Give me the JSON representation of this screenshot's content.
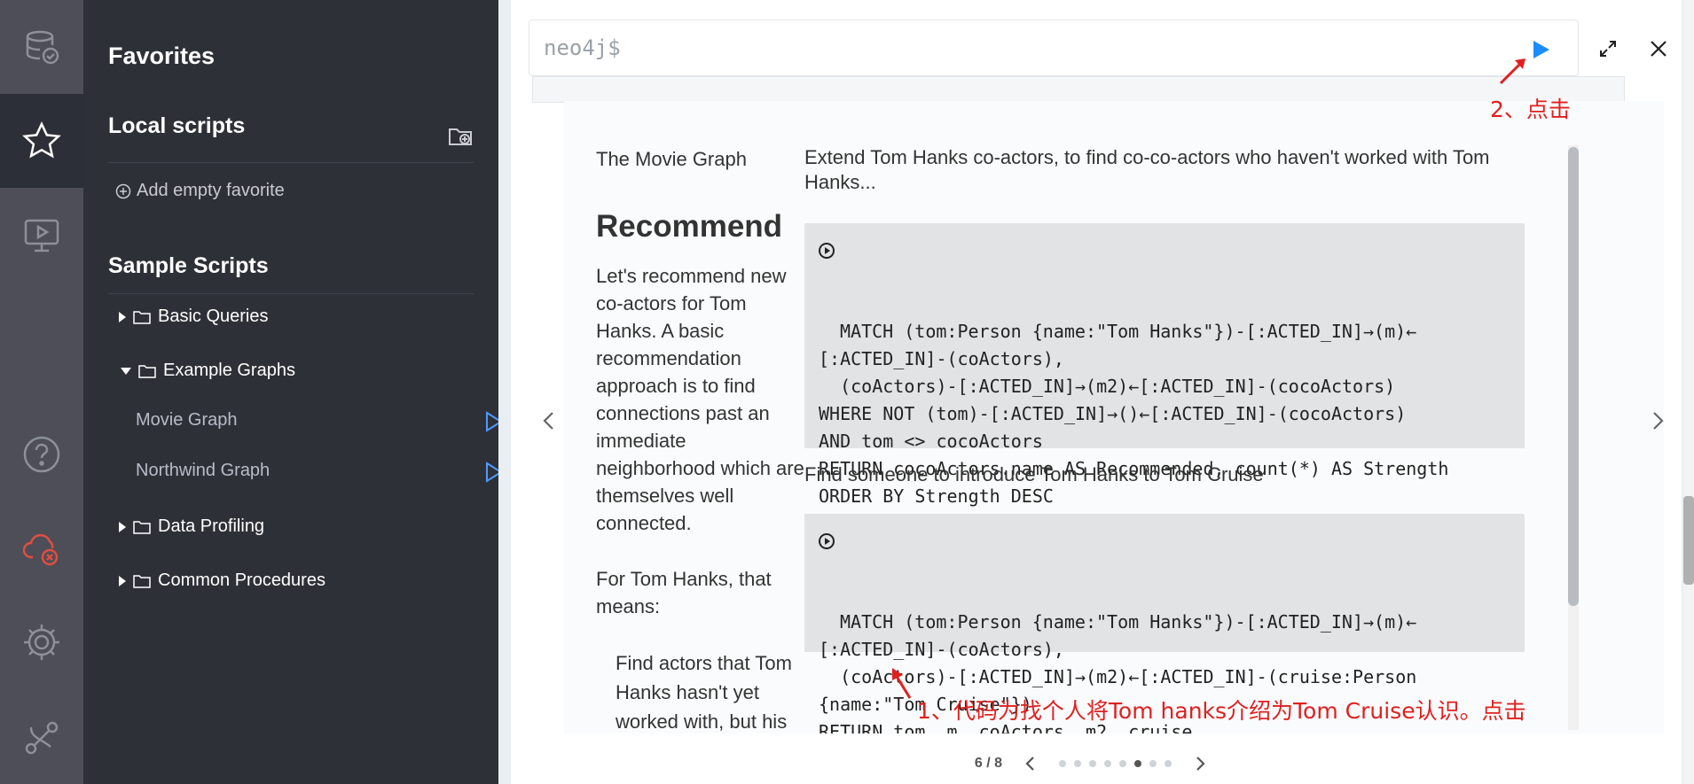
{
  "sidebar": {
    "title": "Favorites",
    "local_scripts": "Local scripts",
    "add_favorite": "Add empty favorite",
    "sample_scripts": "Sample Scripts",
    "folders": [
      {
        "label": "Basic Queries",
        "expanded": false
      },
      {
        "label": "Example Graphs",
        "expanded": true
      },
      {
        "label": "Data Profiling",
        "expanded": false
      },
      {
        "label": "Common Procedures",
        "expanded": false
      }
    ],
    "example_items": [
      {
        "label": "Movie Graph"
      },
      {
        "label": "Northwind Graph"
      }
    ]
  },
  "editor": {
    "prompt": "neo4j$"
  },
  "guide": {
    "section_title": "The Movie Graph",
    "heading": "Recommend",
    "paragraph1": "Let's recommend new co-actors for Tom Hanks. A basic recommendation approach is to find connections past an immediate neighborhood which are themselves well connected.",
    "paragraph2": "For Tom Hanks, that means:",
    "paragraph3": "Find actors that Tom Hanks hasn't yet worked with, but his",
    "intro1": "Extend Tom Hanks co-actors, to find co-co-actors who haven't worked with Tom Hanks...",
    "code1": "MATCH (tom:Person {name:\"Tom Hanks\"})-[:ACTED_IN]→(m)←\n[:ACTED_IN]-(coActors),\n  (coActors)-[:ACTED_IN]→(m2)←[:ACTED_IN]-(cocoActors)\nWHERE NOT (tom)-[:ACTED_IN]→()←[:ACTED_IN]-(cocoActors)\nAND tom <> cocoActors\nRETURN cocoActors.name AS Recommended, count(*) AS Strength\nORDER BY Strength DESC",
    "intro2": "Find someone to introduce Tom Hanks to Tom Cruise",
    "code2": "MATCH (tom:Person {name:\"Tom Hanks\"})-[:ACTED_IN]→(m)←\n[:ACTED_IN]-(coActors),\n  (coActors)-[:ACTED_IN]→(m2)←[:ACTED_IN]-(cruise:Person\n{name:\"Tom Cruise\"})\nRETURN tom, m, coActors, m2, cruise"
  },
  "pagination": {
    "label": "6 / 8",
    "total": 8,
    "current": 6
  },
  "annotations": {
    "step1": "1、代码为找个人将Tom hanks介绍为Tom Cruise认识。点击",
    "step2": "2、点击",
    "color": "#e02020"
  },
  "colors": {
    "accent": "#1a8cff",
    "sidebar_bg": "#2e3038",
    "rail_bg": "#4d4e57",
    "error": "#e24d3f"
  },
  "icons": [
    "database-icon",
    "star-icon",
    "monitor-play-icon",
    "help-icon",
    "cloud-disconnected-icon",
    "gear-icon",
    "plugin-icon",
    "play-icon",
    "expand-icon",
    "close-icon"
  ]
}
